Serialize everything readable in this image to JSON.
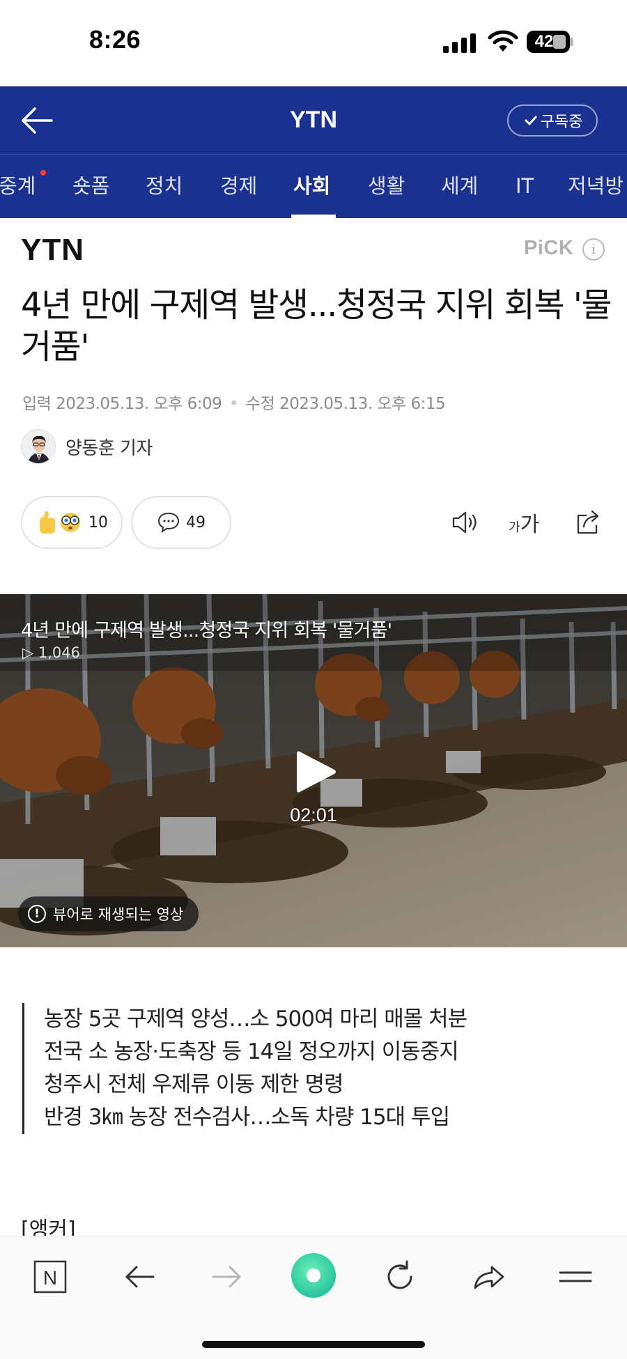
{
  "status_bar": {
    "time": "8:26",
    "battery": "42"
  },
  "header": {
    "channel": "YTN",
    "subscribe_label": "구독중"
  },
  "nav": {
    "tabs": [
      {
        "label": "중계"
      },
      {
        "label": "숏폼"
      },
      {
        "label": "정치"
      },
      {
        "label": "경제"
      },
      {
        "label": "사회"
      },
      {
        "label": "생활"
      },
      {
        "label": "세계"
      },
      {
        "label": "IT"
      },
      {
        "label": "저녁방"
      }
    ],
    "active_tab": "사회"
  },
  "article": {
    "press_logo": "YTN",
    "pick_label": "PiCK",
    "pick_info": "i",
    "headline": "4년 만에 구제역 발생...청정국 지위 회복 '물거품'",
    "input_label": "입력",
    "input_date": "2023.05.13. 오후 6:09",
    "modified_label": "수정",
    "modified_date": "2023.05.13. 오후 6:15",
    "reporter": "양동훈 기자",
    "reaction_count": "10",
    "comment_count": "49",
    "font_size_small": "가",
    "font_size_large": "가"
  },
  "video": {
    "title": "4년 만에 구제역 발생...청정국 지위 회복 '물거품'",
    "views": "1,046",
    "duration": "02:01",
    "viewer_badge": "뷰어로 재생되는 영상"
  },
  "summary": [
    "농장 5곳 구제역 양성…소 500여 마리 매몰 처분",
    "전국 소 농장·도축장 등 14일 정오까지 이동중지",
    "청주시 전체 우제류 이동 제한 명령",
    "반경 3㎞ 농장 전수검사…소독 차량 15대 투입"
  ],
  "anchor_label": "[앵커]",
  "toolbar": {
    "home_icon_letter": "N"
  },
  "colors": {
    "header_bg": "#1b318f",
    "accent_green": "#28c6a0"
  }
}
